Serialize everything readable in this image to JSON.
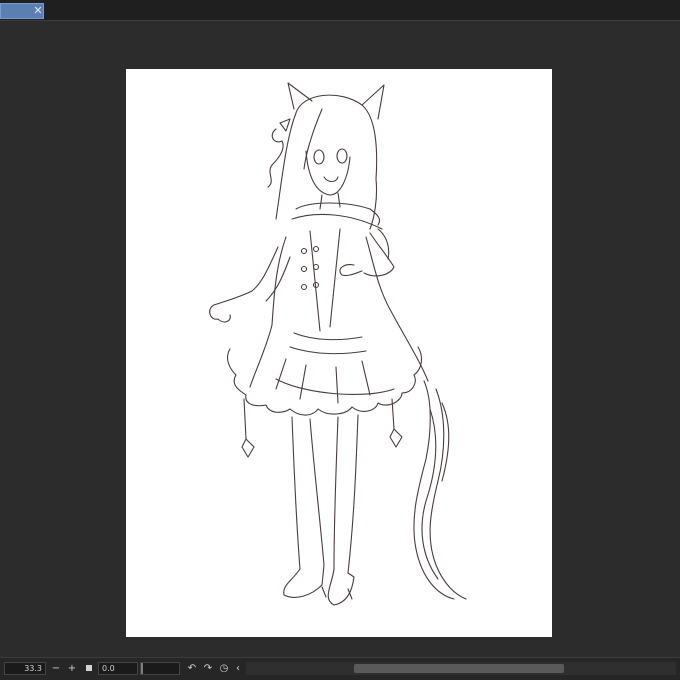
{
  "tabbar": {
    "close_glyph": "✕"
  },
  "statusbar": {
    "zoom_value": "33.3",
    "zoom_out_glyph": "−",
    "zoom_in_glyph": "+",
    "rotate_value": "0.0",
    "rotate_left_glyph": "↶",
    "rotate_right_glyph": "↷",
    "reset_glyph": "◷",
    "flip_glyph": "‹"
  },
  "colors": {
    "workspace": "#2c2c2c",
    "paper": "#ffffff",
    "sketch_line": "#4a3c3c",
    "tab_active": "#5b7fb3"
  },
  "icons": {
    "close": "close-icon",
    "zoom_out": "minus-icon",
    "zoom_in": "plus-icon",
    "fit": "fit-screen-icon",
    "rotate_left": "rotate-left-icon",
    "rotate_right": "rotate-right-icon",
    "reset": "reset-rotation-icon",
    "flip": "flip-icon"
  }
}
